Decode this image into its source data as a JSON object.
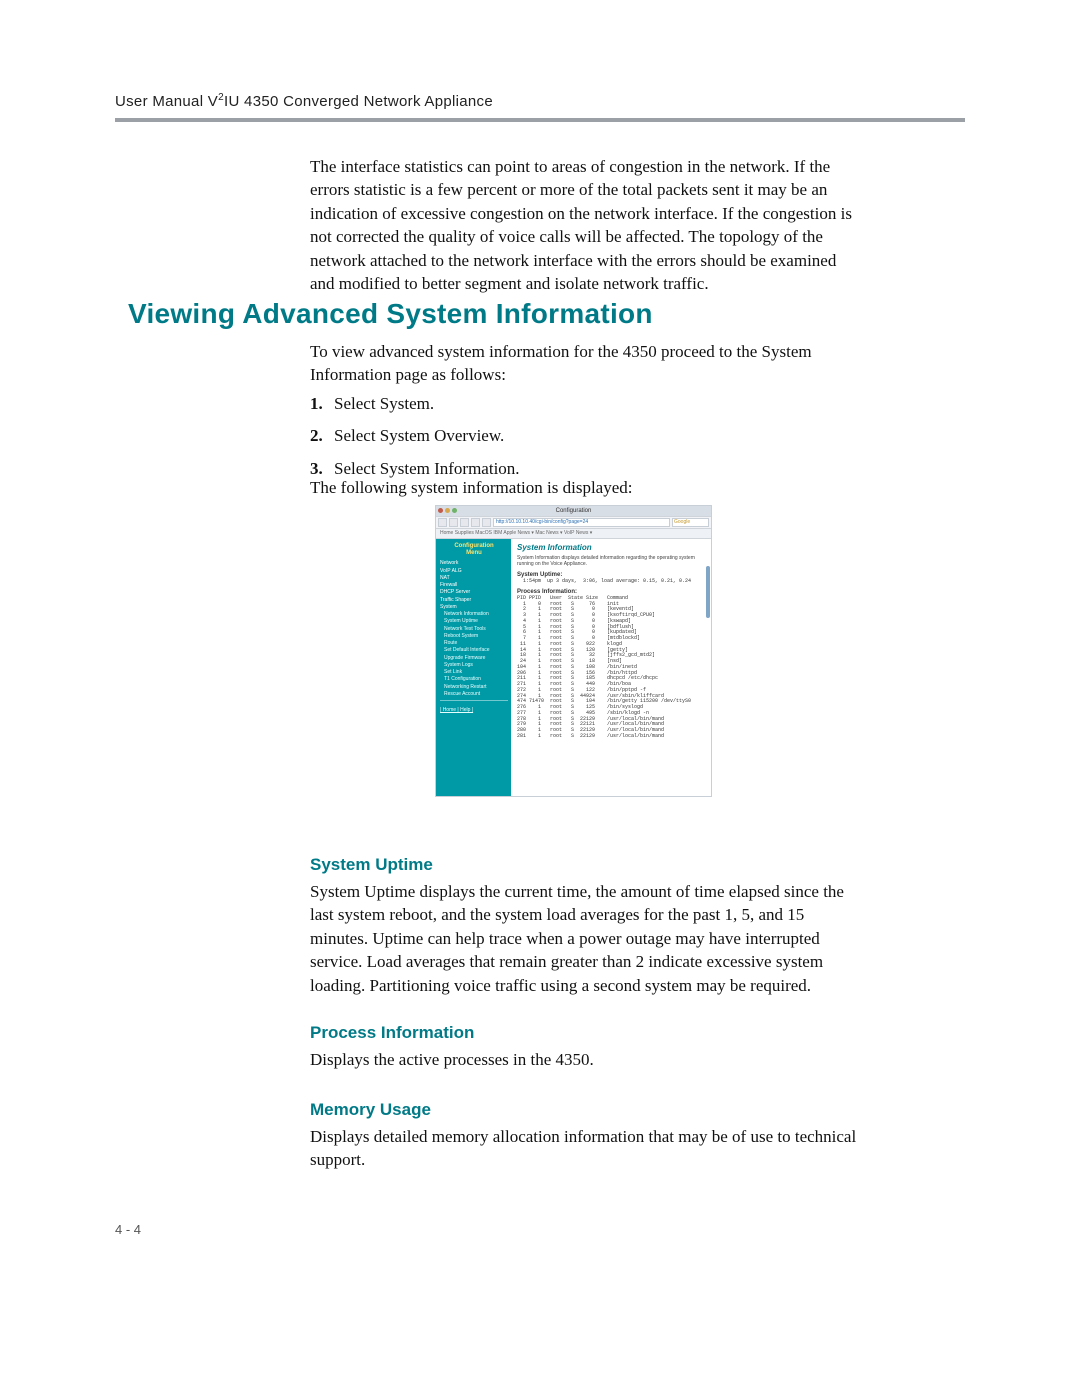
{
  "header": {
    "product_prefix": "User Manual V",
    "product_super": "2",
    "product_suffix": "IU 4350 Converged Network Appliance"
  },
  "intro_paragraph": "The interface statistics can point to areas of congestion in the network. If the errors statistic is a few percent or more of the total packets sent it may be an indication of excessive congestion on the network interface. If the congestion is not corrected the quality of voice calls will be affected. The topology of the network attached to the network interface with the errors should be examined and modified to better segment and isolate network traffic.",
  "section_heading": "Viewing Advanced System Information",
  "para_to_view": "To view advanced system information for the 4350 proceed to the System Information page as follows:",
  "steps": {
    "s1": "Select System.",
    "s2": "Select System Overview.",
    "s3": "Select System Information."
  },
  "para_following": "The following system information is displayed:",
  "uptime": {
    "heading": "System Uptime",
    "body": "System Uptime displays the current time, the amount of time elapsed since the last system reboot, and the system load averages for the past 1, 5, and 15 minutes. Uptime can help trace when a power outage may have interrupted service. Load averages that remain greater than 2 indicate excessive system loading. Partitioning voice traffic using a second system may be required."
  },
  "process": {
    "heading": "Process Information",
    "body": "Displays the active processes in the 4350."
  },
  "memory": {
    "heading": "Memory Usage",
    "body": "Displays detailed memory allocation information that may be of use to technical support."
  },
  "page_number": "4 - 4",
  "screenshot": {
    "window_title": "Configuration",
    "url": "http://10.10.10.40/cgi-bin/config?page=24",
    "search_placeholder": "Google",
    "bookmarks": "Home   Supplies   MacOS   IBM   Apple   News ▾   Mac News ▾   VoIP News ▾",
    "sidebar": {
      "menu_title_l1": "Configuration",
      "menu_title_l2": "Menu",
      "items": {
        "network": "Network",
        "voip_alg": "VoIP ALG",
        "nat": "NAT",
        "firewall": "Firewall",
        "dhcp_server": "DHCP Server",
        "traffic_shaper": "Traffic Shaper",
        "system": "System"
      },
      "subitems": {
        "a": "Network Information",
        "b": "System Uptime",
        "c": "Network Test Tools",
        "d": "Reboot System",
        "e": "Route",
        "f": "Set Default Interface",
        "g": "Upgrade Firmware",
        "h": "System Logs",
        "i": "Set Link",
        "j": "T1 Configuration",
        "k": "Networking Restart",
        "l": "Rescue Account"
      },
      "footer": "| Home | Help |"
    },
    "content": {
      "page_heading": "System Information",
      "desc": "System Information displays detailed information regarding the operating system running on the Voice Appliance.",
      "uptime_h": "System Uptime:",
      "uptime_line": "  1:54pm  up 3 days,  3:06, load average: 0.15, 0.21, 0.24",
      "process_h": "Process Information:",
      "process_rows": [
        "PID PPID   User  State Size   Command",
        "  1    0   root   S     76    init",
        "  2    1   root   S      0    [keventd]",
        "  3    1   root   S      0    [ksoftirqd_CPU0]",
        "  4    1   root   S      0    [kswapd]",
        "  5    1   root   S      0    [bdflush]",
        "  6    1   root   S      0    [kupdated]",
        "  7    1   root   S      0    [mtdblockd]",
        " 11    1   root   S    922    klogd",
        " 14    1   root   S    120    [getty]",
        " 18    1   root   S     32    [jffs2_gcd_mtd2]",
        " 24    1   root   S     18    [nsd]",
        "104    1   root   S    108    /bin/inetd",
        "206    1   root   S    156    /bin/httpd",
        "211    1   root   S    185    dhcpcd /etc/dhcpc",
        "271    1   root   S    449    /bin/boa",
        "272    1   root   S    122    /bin/pptpd -f",
        "274    1   root   S  44924    /usr/sbin/kliffcard",
        "474 71470  root   S    104    /bin/getty 115200 /dev/ttyS0",
        "276    1   root   S    125    /bin/syslogd",
        "277    1   root   S    495    /sbin/klogd -n",
        "278    1   root   S  22129    /usr/local/bin/mand",
        "279    1   root   S  22121    /usr/local/bin/mand",
        "280    1   root   S  22129    /usr/local/bin/mand",
        "281    1   root   S  22129    /usr/local/bin/mand"
      ]
    }
  }
}
